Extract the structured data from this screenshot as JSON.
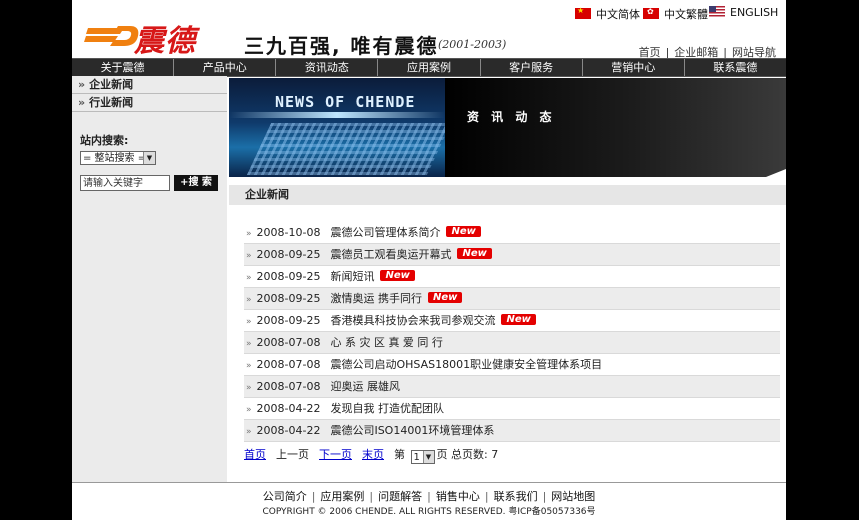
{
  "header": {
    "logo_text": "震德",
    "slogan": "三九百强, 唯有震德",
    "slogan_years": "(2001-2003)",
    "languages": [
      "中文简体",
      "中文繁體",
      "ENGLISH"
    ],
    "toplinks": [
      "首页",
      "企业邮箱",
      "网站导航"
    ]
  },
  "nav": [
    "关于震德",
    "产品中心",
    "资讯动态",
    "应用案例",
    "客户服务",
    "营销中心",
    "联系震德"
  ],
  "sidebar": {
    "links": [
      "企业新闻",
      "行业新闻"
    ],
    "search_title": "站内搜索:",
    "search_select": "= 整站搜索 =",
    "search_placeholder": "请输入关键字",
    "search_button": "+搜 索"
  },
  "banner": {
    "image_title": "NEWS OF CHENDE",
    "label": "资 讯 动 态"
  },
  "section_title": "企业新闻",
  "news": [
    {
      "date": "2008-10-08",
      "title": "震德公司管理体系简介",
      "badge": "New"
    },
    {
      "date": "2008-09-25",
      "title": "震德员工观看奥运开幕式",
      "badge": "New"
    },
    {
      "date": "2008-09-25",
      "title": "新闻短讯",
      "badge": "New"
    },
    {
      "date": "2008-09-25",
      "title": "激情奥运 携手同行",
      "badge": "New"
    },
    {
      "date": "2008-09-25",
      "title": "香港模具科技协会来我司参观交流",
      "badge": "New"
    },
    {
      "date": "2008-07-08",
      "title": "心 系 灾 区 真 爱 同 行",
      "badge": ""
    },
    {
      "date": "2008-07-08",
      "title": "震德公司启动OHSAS18001职业健康安全管理体系项目",
      "badge": ""
    },
    {
      "date": "2008-07-08",
      "title": "迎奥运 展雄风",
      "badge": ""
    },
    {
      "date": "2008-04-22",
      "title": "发现自我 打造优配团队",
      "badge": ""
    },
    {
      "date": "2008-04-22",
      "title": "震德公司ISO14001环境管理体系",
      "badge": ""
    }
  ],
  "pager": {
    "first": "首页",
    "prev": "上一页",
    "next": "下一页",
    "last": "末页",
    "page_prefix": "第",
    "page_value": "1",
    "page_suffix": "页 总页数: 7"
  },
  "footer": {
    "links": [
      "公司简介",
      "应用案例",
      "问题解答",
      "销售中心",
      "联系我们",
      "网站地图"
    ],
    "copyright": "COPYRIGHT © 2006 CHENDE. ALL RIGHTS RESERVED. 粤ICP备05057336号"
  },
  "colors": {
    "brand_red": "#d71818",
    "nav_bg": "#2a2a2a",
    "badge_red": "#e40000",
    "link_blue": "#0000cc"
  }
}
